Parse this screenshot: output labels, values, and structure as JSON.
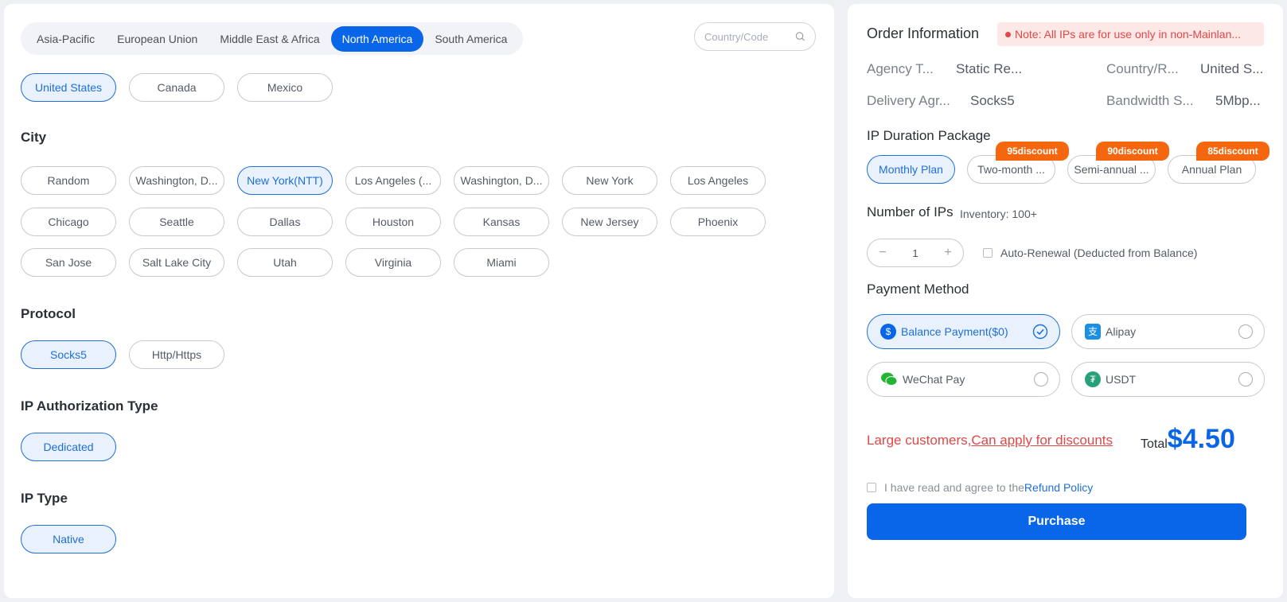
{
  "regions": [
    "Asia-Pacific",
    "European Union",
    "Middle East & Africa",
    "North America",
    "South America"
  ],
  "search": {
    "placeholder": "Country/Code"
  },
  "countries": [
    "United States",
    "Canada",
    "Mexico"
  ],
  "city": {
    "title": "City",
    "items": [
      "Random",
      "Washington, D...",
      "New York(NTT)",
      "Los Angeles (...",
      "Washington, D...",
      "New York",
      "Los Angeles",
      "Chicago",
      "Seattle",
      "Dallas",
      "Houston",
      "Kansas",
      "New Jersey",
      "Phoenix",
      "San Jose",
      "Salt Lake City",
      "Utah",
      "Virginia",
      "Miami"
    ]
  },
  "protocol": {
    "title": "Protocol",
    "items": [
      "Socks5",
      "Http/Https"
    ]
  },
  "auth": {
    "title": "IP Authorization Type",
    "items": [
      "Dedicated"
    ]
  },
  "iptype": {
    "title": "IP Type",
    "items": [
      "Native"
    ]
  },
  "order": {
    "title": "Order Information",
    "note": "Note: All IPs are for use only in non-Mainlan...",
    "agency_label": "Agency T...",
    "agency_value": "Static Re...",
    "country_label": "Country/R...",
    "country_value": "United S...",
    "delivery_label": "Delivery Agr...",
    "delivery_value": "Socks5",
    "bandwidth_label": "Bandwidth S...",
    "bandwidth_value": "5Mbp..."
  },
  "duration": {
    "title": "IP Duration Package",
    "plans": [
      "Monthly Plan",
      "Two-month ...",
      "Semi-annual ...",
      "Annual Plan"
    ],
    "discounts": [
      "95discount",
      "90discount",
      "85discount"
    ]
  },
  "ips": {
    "title": "Number of IPs",
    "inventory": "Inventory: 100+",
    "minus": "−",
    "quantity": "1",
    "plus": "+",
    "auto_renewal": "Auto-Renewal (Deducted from Balance)"
  },
  "payment": {
    "title": "Payment Method",
    "balance": "Balance Payment($0)",
    "balance_icon_glyph": "$",
    "alipay": "Alipay",
    "alipay_icon_glyph": "支",
    "wechat": "WeChat Pay",
    "usdt": "USDT",
    "usdt_icon_glyph": "₮"
  },
  "discount_text": {
    "prefix": "Large customers,",
    "link": "Can apply for discounts"
  },
  "total": {
    "label": "Total",
    "amount": "$4.50"
  },
  "agree": {
    "text": "I have read and agree to the",
    "link": "Refund Policy"
  },
  "purchase_label": "Purchase",
  "colors": {
    "primary": "#0a66e8",
    "danger": "#e04848",
    "discount": "#f5670e"
  }
}
